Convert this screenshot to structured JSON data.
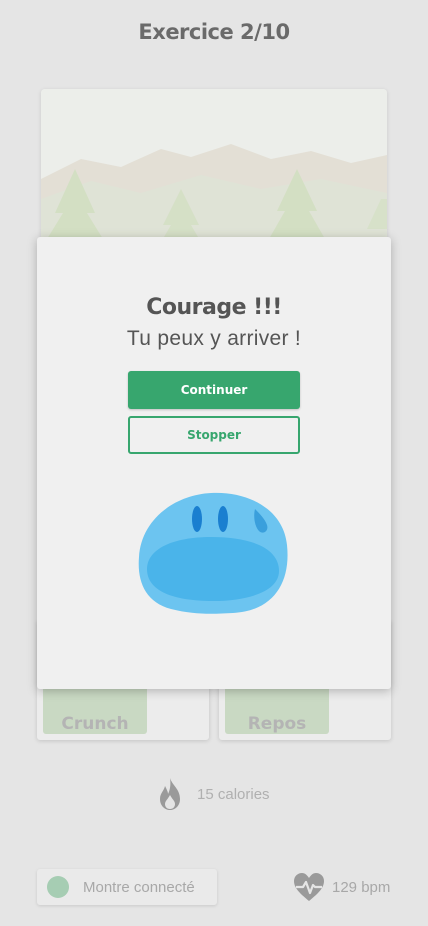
{
  "header": {
    "title": "Exercice 2/10"
  },
  "cards": [
    {
      "label": "Crunch"
    },
    {
      "label": "Repos"
    }
  ],
  "stats": {
    "calories": "15 calories",
    "watch_status": "Montre connecté",
    "heart_rate": "129 bpm"
  },
  "modal": {
    "heading": "Courage !!!",
    "subtitle": "Tu peux y arriver !",
    "continue_label": "Continuer",
    "stop_label": "Stopper"
  },
  "colors": {
    "primary": "#37a66e",
    "mascot": "#5bbbec",
    "watch_dot": "#a6cdb3"
  },
  "icons": [
    "flame-icon",
    "heart-pulse-icon",
    "mountains-illustration",
    "mascot-blob"
  ]
}
